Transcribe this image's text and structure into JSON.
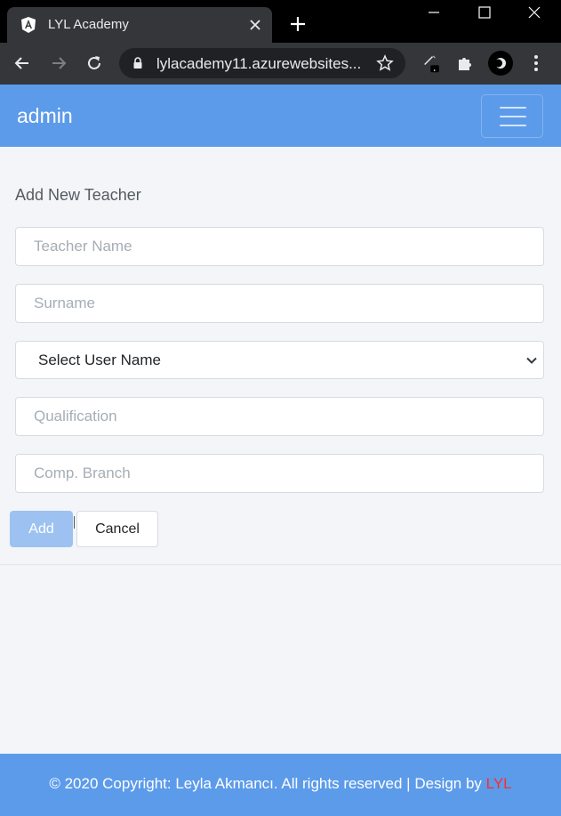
{
  "browser": {
    "tab_title": "LYL Academy",
    "url": "lylacademy11.azurewebsites..."
  },
  "navbar": {
    "brand": "admin"
  },
  "form": {
    "title": "Add New Teacher",
    "teacher_name_placeholder": "Teacher Name",
    "surname_placeholder": "Surname",
    "user_select_value": "Select User Name",
    "qualification_placeholder": "Qualification",
    "branch_placeholder": "Comp. Branch",
    "add_label": "Add",
    "cancel_label": "Cancel"
  },
  "footer": {
    "text": "© 2020 Copyright: Leyla Akmancı. All rights reserved | Design by ",
    "link": "LYL"
  },
  "colors": {
    "primary": "#5c9bea",
    "add_button": "#9dc2f1",
    "footer_link": "#ff2b2b"
  },
  "icons": [
    "angular-icon",
    "close-icon",
    "plus-icon",
    "minimize-icon",
    "maximize-icon",
    "window-close-icon",
    "back-arrow-icon",
    "forward-arrow-icon",
    "reload-icon",
    "lock-icon",
    "star-icon",
    "pen-icon",
    "puzzle-icon",
    "profile-icon",
    "kebab-menu-icon",
    "hamburger-icon",
    "chevron-down-icon"
  ]
}
